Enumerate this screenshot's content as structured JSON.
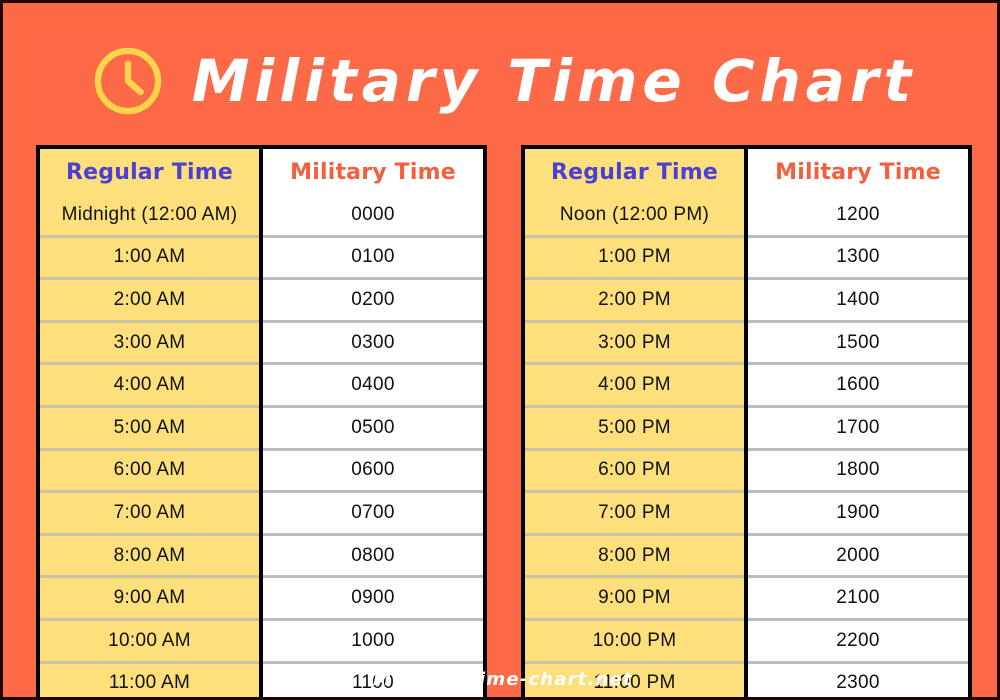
{
  "header": {
    "title": "Military Time Chart",
    "icon": "clock-icon",
    "title_color": "#ffffff",
    "icon_color": "#fcd34d"
  },
  "theme": {
    "background": "#fc6a48",
    "page_border": "#1d0502",
    "regular_cell_bg": "#fde07c",
    "military_cell_bg": "#ffffff",
    "regular_header_color": "#4b3fd6",
    "military_header_color": "#f4603e",
    "table_border": "#000000",
    "row_divider_yellow": "#c9c3ab",
    "row_divider_white": "#bdbdbd"
  },
  "footer": {
    "text": "Military-time-chart.net"
  },
  "chart_data": {
    "type": "table",
    "title": "Military Time Chart",
    "columns": [
      "Regular Time",
      "Military Time"
    ],
    "tables": [
      {
        "name": "am-table",
        "headers": [
          "Regular Time",
          "Military Time"
        ],
        "rows": [
          [
            "Midnight (12:00 AM)",
            "0000"
          ],
          [
            "1:00 AM",
            "0100"
          ],
          [
            "2:00 AM",
            "0200"
          ],
          [
            "3:00 AM",
            "0300"
          ],
          [
            "4:00 AM",
            "0400"
          ],
          [
            "5:00 AM",
            "0500"
          ],
          [
            "6:00 AM",
            "0600"
          ],
          [
            "7:00 AM",
            "0700"
          ],
          [
            "8:00 AM",
            "0800"
          ],
          [
            "9:00 AM",
            "0900"
          ],
          [
            "10:00 AM",
            "1000"
          ],
          [
            "11:00 AM",
            "1100"
          ]
        ]
      },
      {
        "name": "pm-table",
        "headers": [
          "Regular Time",
          "Military Time"
        ],
        "rows": [
          [
            "Noon (12:00 PM)",
            "1200"
          ],
          [
            "1:00 PM",
            "1300"
          ],
          [
            "2:00 PM",
            "1400"
          ],
          [
            "3:00 PM",
            "1500"
          ],
          [
            "4:00 PM",
            "1600"
          ],
          [
            "5:00 PM",
            "1700"
          ],
          [
            "6:00 PM",
            "1800"
          ],
          [
            "7:00 PM",
            "1900"
          ],
          [
            "8:00 PM",
            "2000"
          ],
          [
            "9:00 PM",
            "2100"
          ],
          [
            "10:00 PM",
            "2200"
          ],
          [
            "11:00 PM",
            "2300"
          ]
        ]
      }
    ]
  }
}
